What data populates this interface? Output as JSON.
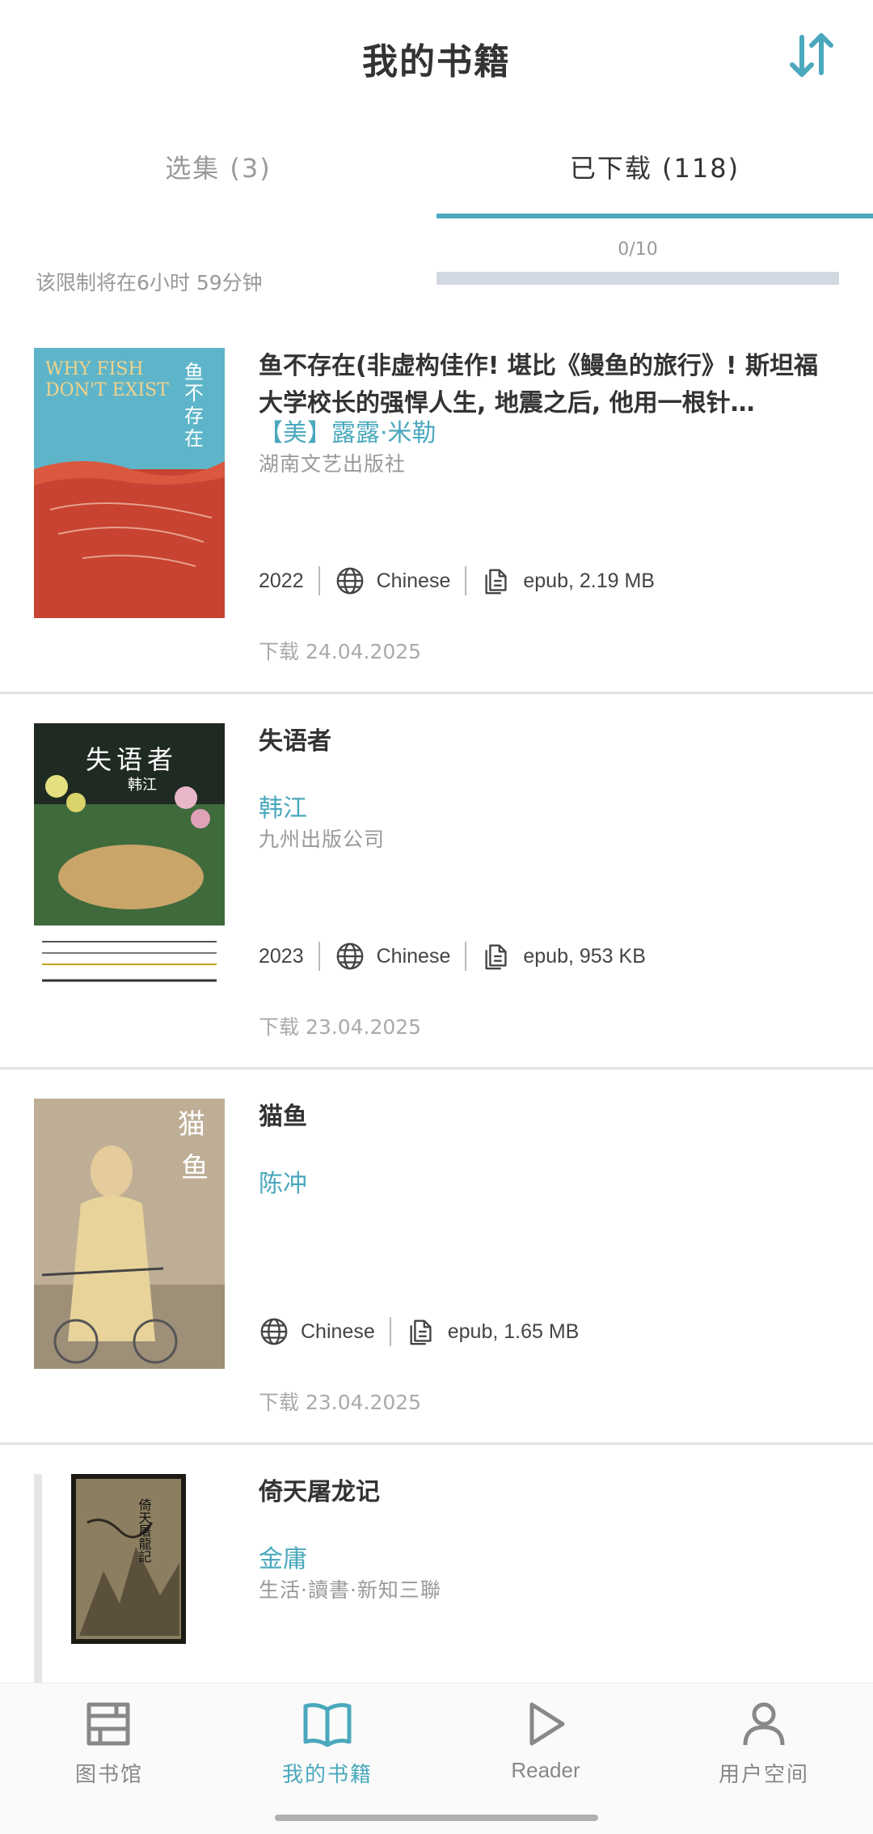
{
  "header": {
    "title": "我的书籍",
    "sort_icon": "sort-arrows-icon"
  },
  "tabs": [
    {
      "label": "选集 (3)",
      "active": false
    },
    {
      "label": "已下载 (118)",
      "active": true
    }
  ],
  "limit": {
    "counter": "0/10",
    "progress": 0,
    "note": "该限制将在6小时 59分钟"
  },
  "books": [
    {
      "title": "鱼不存在(非虚构佳作! 堪比《鳗鱼的旅行》! 斯坦福大学校长的强悍人生, 地震之后, 他用一根针…",
      "author": "【美】露露·米勒",
      "publisher": "湖南文艺出版社",
      "year": "2022",
      "language": "Chinese",
      "file": "epub, 2.19 MB",
      "downloaded": "下载 24.04.2025",
      "cover": {
        "en_title_1": "WHY FISH",
        "en_title_2": "DON'T EXIST",
        "zh_title_1": "鱼",
        "zh_title_2": "不存在"
      }
    },
    {
      "title": "失语者",
      "author": "韩江",
      "publisher": "九州出版公司",
      "year": "2023",
      "language": "Chinese",
      "file": "epub, 953 KB",
      "downloaded": "下载 23.04.2025",
      "cover": {
        "zh_title": "失语者",
        "author": "韩江"
      }
    },
    {
      "title": "猫鱼",
      "author": "陈冲",
      "publisher": "",
      "year": "",
      "language": "Chinese",
      "file": "epub, 1.65 MB",
      "downloaded": "下载 23.04.2025",
      "cover": {
        "zh_title_1": "猫",
        "zh_title_2": "鱼"
      }
    },
    {
      "title": "倚天屠龙记",
      "author": "金庸",
      "publisher": "生活·讀書·新知三聯"
    }
  ],
  "nav": [
    {
      "label": "图书馆",
      "icon": "library-icon",
      "active": false
    },
    {
      "label": "我的书籍",
      "icon": "open-book-icon",
      "active": true
    },
    {
      "label": "Reader",
      "icon": "play-icon",
      "active": false
    },
    {
      "label": "用户空间",
      "icon": "user-icon",
      "active": false
    }
  ],
  "colors": {
    "accent": "#4aa8bd",
    "text": "#333333",
    "muted": "#999999",
    "progress_track": "#d3d9e3"
  }
}
